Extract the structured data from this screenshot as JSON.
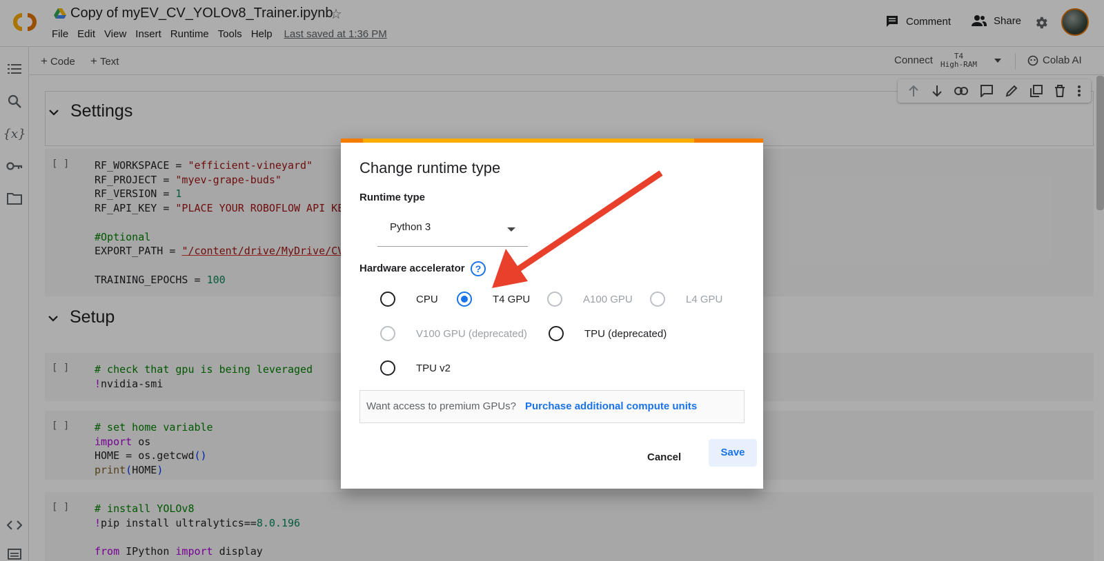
{
  "header": {
    "notebook_title": "Copy of myEV_CV_YOLOv8_Trainer.ipynb",
    "logo_text": "CO",
    "menu": [
      "File",
      "Edit",
      "View",
      "Insert",
      "Runtime",
      "Tools",
      "Help"
    ],
    "last_saved": "Last saved at 1:36 PM",
    "comment_label": "Comment",
    "share_label": "Share"
  },
  "toolbar": {
    "add_code": "Code",
    "add_text": "Text",
    "connect": "Connect",
    "runtime_line1": "T4",
    "runtime_line2": "High-RAM",
    "colab_ai": "Colab AI"
  },
  "notebook": {
    "settings_title": "Settings",
    "setup_title": "Setup",
    "cell_bracket": "[ ]"
  },
  "dialog": {
    "title": "Change runtime type",
    "runtime_type_label": "Runtime type",
    "runtime_type_value": "Python 3",
    "hardware_label": "Hardware accelerator",
    "help_glyph": "?",
    "options": [
      {
        "label": "CPU",
        "state": "enabled"
      },
      {
        "label": "T4 GPU",
        "state": "checked"
      },
      {
        "label": "A100 GPU",
        "state": "disabled"
      },
      {
        "label": "L4 GPU",
        "state": "disabled"
      },
      {
        "label": "V100 GPU (deprecated)",
        "state": "disabled"
      },
      {
        "label": "TPU (deprecated)",
        "state": "enabled"
      },
      {
        "label": "TPU v2",
        "state": "enabled"
      }
    ],
    "premium_question": "Want access to premium GPUs?",
    "premium_link": "Purchase additional compute units",
    "cancel_label": "Cancel",
    "save_label": "Save"
  },
  "colors": {
    "accent": "#1a73e8",
    "annotation_arrow": "#e8402a",
    "progress": "#f9ab00"
  }
}
